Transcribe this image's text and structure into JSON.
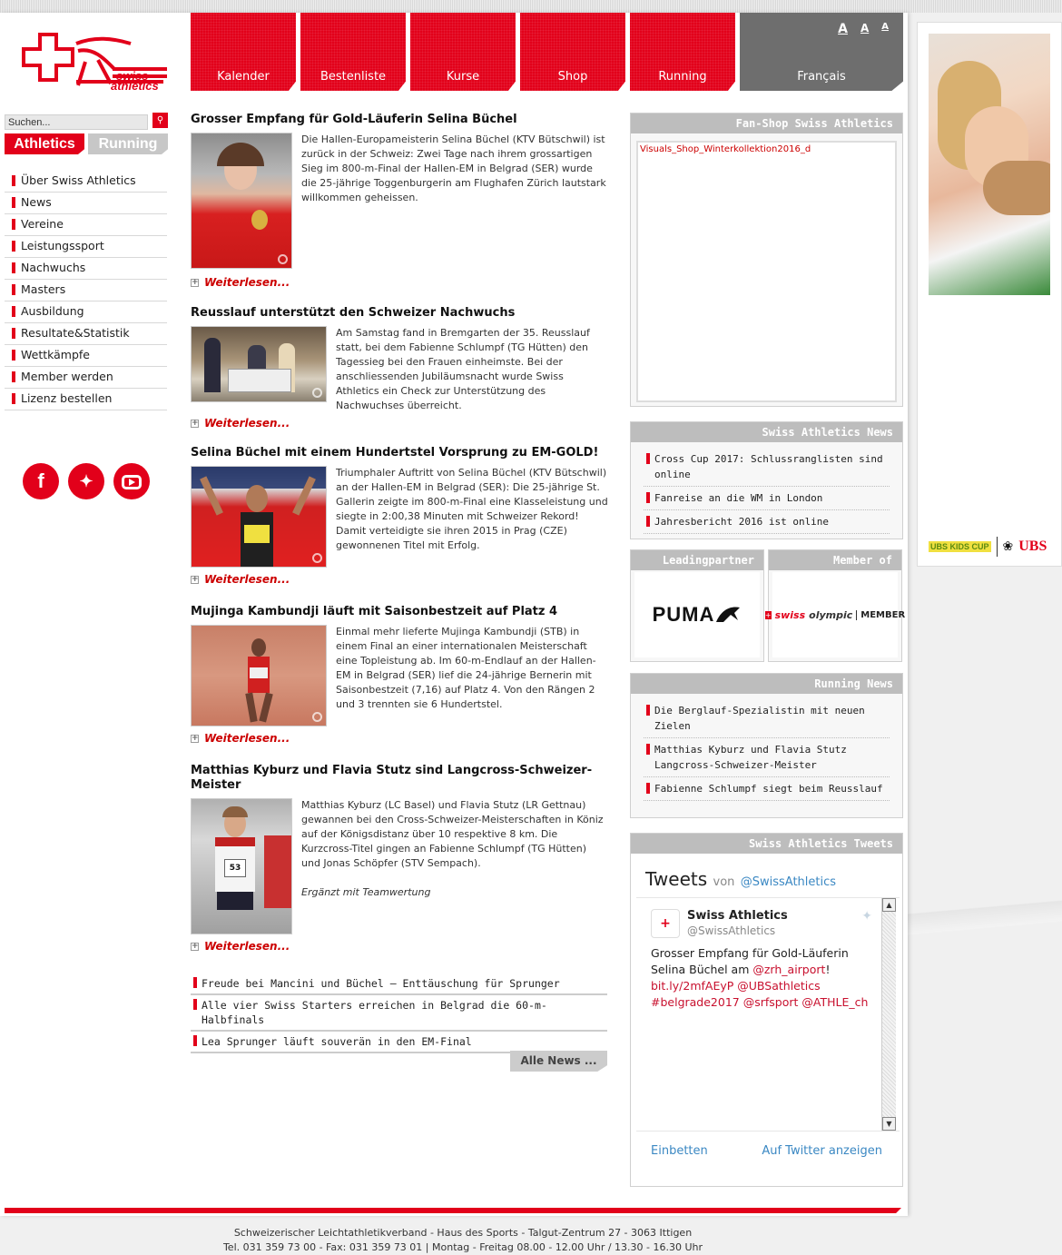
{
  "logo": {
    "line1": "swiss",
    "line2": "athletics"
  },
  "nav": {
    "tabs": [
      "Kalender",
      "Bestenliste",
      "Kurse",
      "Shop",
      "Running"
    ],
    "language": "Français",
    "font_sizes": [
      "A",
      "A",
      "A"
    ]
  },
  "search": {
    "placeholder": "Suchen..."
  },
  "switch": {
    "athletics": "Athletics",
    "running": "Running"
  },
  "left_menu": [
    "Über Swiss Athletics",
    "News",
    "Vereine",
    "Leistungssport",
    "Nachwuchs",
    "Masters",
    "Ausbildung",
    "Resultate&Statistik",
    "Wettkämpfe",
    "Member werden",
    "Lizenz bestellen"
  ],
  "social": [
    "facebook-icon",
    "twitter-icon",
    "youtube-icon"
  ],
  "articles": [
    {
      "title": "Grosser Empfang für Gold-Läuferin Selina Büchel",
      "text": "Die Hallen-Europameisterin Selina Büchel (KTV Bütschwil) ist zurück in der Schweiz: Zwei Tage nach ihrem grossartigen Sieg im 800-m-Final der Hallen-EM in Belgrad (SER) wurde die 25-jährige Toggenburgerin am Flughafen Zürich lautstark willkommen geheissen.",
      "more": "Weiterlesen..."
    },
    {
      "title": "Reusslauf unterstützt den Schweizer Nachwuchs",
      "text": "Am Samstag fand in Bremgarten der 35. Reusslauf statt, bei dem Fabienne Schlumpf (TG Hütten) den Tagessieg bei den Frauen einheimste. Bei der anschliessenden Jubiläumsnacht wurde Swiss Athletics ein Check zur Unterstützung des Nachwuchses überreicht.",
      "more": "Weiterlesen..."
    },
    {
      "title": "Selina Büchel mit einem Hundertstel Vorsprung zu EM-GOLD!",
      "text": "Triumphaler Auftritt von Selina Büchel (KTV Bütschwil) an der Hallen-EM in Belgrad (SER): Die 25-jährige St. Gallerin zeigte im 800-m-Final eine Klasseleistung und siegte in 2:00,38 Minuten mit Schweizer Rekord! Damit verteidigte sie ihren 2015 in Prag (CZE) gewonnenen Titel mit Erfolg.",
      "more": "Weiterlesen..."
    },
    {
      "title": "Mujinga Kambundji läuft mit Saisonbestzeit auf Platz 4",
      "text": "Einmal mehr lieferte Mujinga Kambundji (STB) in einem Final an einer internationalen Meisterschaft eine Topleistung ab. Im 60-m-Endlauf an der Hallen-EM in Belgrad (SER) lief die 24-jährige Bernerin mit Saisonbestzeit (7,16) auf Platz 4. Von den Rängen 2 und 3 trennten sie 6 Hundertstel.",
      "more": "Weiterlesen..."
    },
    {
      "title": "Matthias Kyburz und Flavia Stutz sind Langcross-Schweizer-Meister",
      "text": "Matthias Kyburz (LC Basel) und Flavia Stutz (LR Gettnau) gewannen bei den Cross-Schweizer-Meisterschaften in Köniz auf der Königsdistanz über 10 respektive 8 km. Die Kurzcross-Titel gingen an Fabienne Schlumpf (TG Hütten) und Jonas Schöpfer (STV Sempach).",
      "note": "Ergänzt mit Teamwertung",
      "more": "Weiterlesen..."
    }
  ],
  "short_news": [
    "Freude bei Mancini und Büchel – Enttäuschung für Sprunger",
    "Alle vier Swiss Starters erreichen in Belgrad die 60-m-Halbfinals",
    "Lea Sprunger läuft souverän in den EM-Final"
  ],
  "all_news": "Alle News ...",
  "fanshop": {
    "title": "Fan-Shop Swiss Athletics",
    "frame_text": "Visuals_Shop_Winterkollektion2016_d"
  },
  "sa_news": {
    "title": "Swiss Athletics News",
    "items": [
      "Cross Cup 2017: Schlussranglisten sind online",
      "Fanreise an die WM in London",
      "Jahresbericht 2016 ist online"
    ]
  },
  "leadingpartner": {
    "title": "Leadingpartner",
    "logo": "PUMA"
  },
  "member_of": {
    "title": "Member of",
    "swiss": "swiss",
    "olympic": "olympic",
    "member": "MEMBER"
  },
  "running_news": {
    "title": "Running News",
    "items": [
      "Die Berglauf-Spezialistin mit neuen Zielen",
      "Matthias Kyburz und Flavia Stutz Langcross-Schweizer-Meister",
      "Fabienne Schlumpf siegt beim Reusslauf"
    ]
  },
  "tweets_box": {
    "title": "Swiss Athletics Tweets",
    "heading": "Tweets",
    "von": "von",
    "handle": "@SwissAthletics",
    "tweet": {
      "name": "Swiss Athletics",
      "handle": "@SwissAthletics",
      "text_1": "Grosser Empfang für Gold-Läuferin Selina Büchel am ",
      "mention_1": "@zrh_airport",
      "text_2": "!",
      "link": "bit.ly/2mfAEyP",
      "mention_2": "@UBSathletics",
      "hashtag": "#belgrade2017",
      "mention_3": "@srfsport",
      "mention_4": "@ATHLE_ch"
    },
    "embed": "Einbetten",
    "view": "Auf Twitter anzeigen"
  },
  "ad": {
    "kids": "UBS KIDS CUP",
    "ubs": "UBS"
  },
  "footer": {
    "line1": "Schweizerischer Leichtathletikverband - Haus des Sports - Talgut-Zentrum 27 - 3063 Ittigen",
    "line2": "Tel. 031 359 73 00 - Fax: 031 359 73 01 | Montag - Freitag 08.00 - 12.00 Uhr / 13.30 - 16.30 Uhr"
  },
  "colors": {
    "brand_red": "#e2001a",
    "grey_tab": "#6e6e6e",
    "box_head": "#bdbdbd"
  }
}
